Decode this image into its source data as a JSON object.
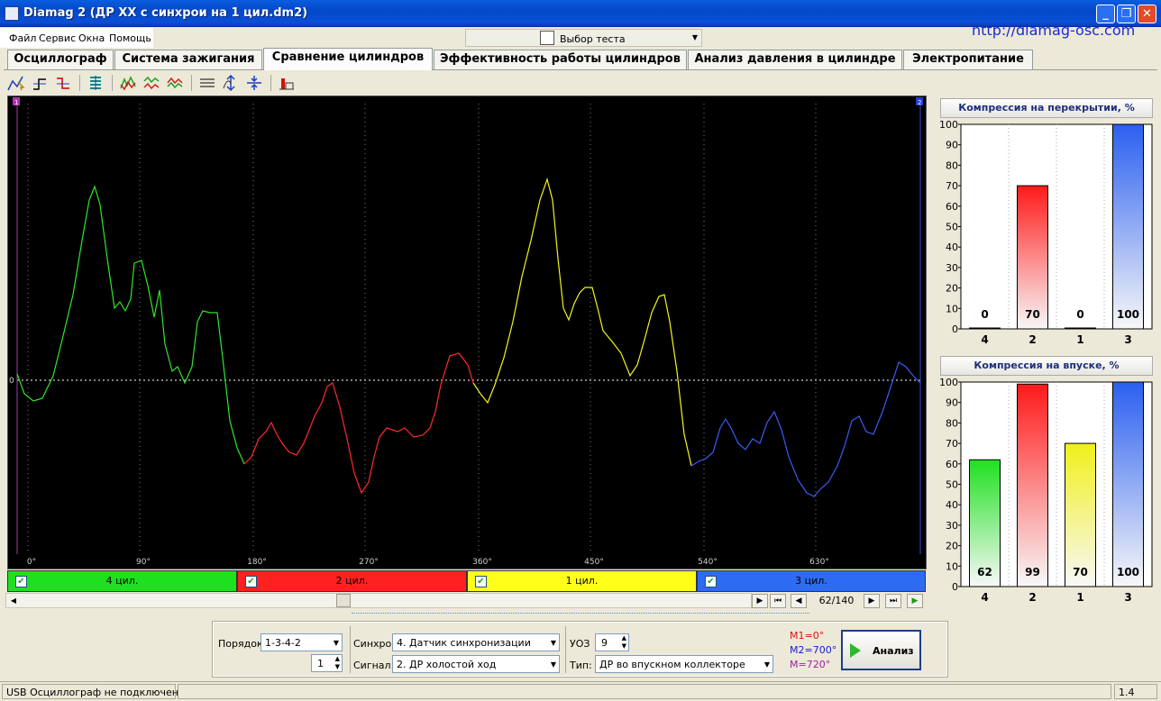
{
  "window": {
    "title": "Diamag 2 (ДР XX с синхрои на 1 цил.dm2)",
    "url": "http://diamag-osc.com"
  },
  "menu": [
    "Файл",
    "Сервис",
    "Окна",
    "Помощь"
  ],
  "test_select": "Выбор теста",
  "tabs": [
    "Осциллограф",
    "Система зажигания",
    "Сравнение цилиндров",
    "Эффективность работы цилиндров",
    "Анализ давления в цилиндре",
    "Электропитание"
  ],
  "active_tab": 2,
  "scope": {
    "x_ticks": [
      "0°",
      "90°",
      "180°",
      "270°",
      "360°",
      "450°",
      "540°",
      "630°"
    ],
    "zero_label": "0",
    "marker_left": "1",
    "marker_right": "2"
  },
  "channels": [
    {
      "label": "4 цил.",
      "color": "#1fe01f",
      "trace": "#2ee62e"
    },
    {
      "label": "2 цил.",
      "color": "#ff2020",
      "trace": "#ff2a2a"
    },
    {
      "label": "1 цил.",
      "color": "#ffff1a",
      "trace": "#f4f41c"
    },
    {
      "label": "3 цил.",
      "color": "#2d6bf4",
      "trace": "#3a5cf2"
    }
  ],
  "nav": {
    "page": "62/140"
  },
  "chart_data": [
    {
      "type": "bar",
      "title": "Компрессия на перекрытии, %",
      "categories": [
        "4",
        "2",
        "1",
        "3"
      ],
      "values": [
        0,
        70,
        0,
        100
      ],
      "ylim": [
        0,
        100
      ],
      "yticks": [
        0,
        10,
        20,
        30,
        40,
        50,
        60,
        70,
        80,
        90,
        100
      ],
      "colors": [
        "#20e020",
        "#ff1a1a",
        "#f0f01a",
        "#2a5ff0"
      ]
    },
    {
      "type": "bar",
      "title": "Компрессия на впуске, %",
      "categories": [
        "4",
        "2",
        "1",
        "3"
      ],
      "values": [
        62,
        99,
        70,
        100
      ],
      "ylim": [
        0,
        100
      ],
      "yticks": [
        0,
        10,
        20,
        30,
        40,
        50,
        60,
        70,
        80,
        90,
        100
      ],
      "colors": [
        "#20e020",
        "#ff1a1a",
        "#f0f01a",
        "#2a5ff0"
      ]
    }
  ],
  "bottom": {
    "order_label": "Порядок",
    "order_value": "1-3-4-2",
    "order_spin": "1",
    "sync_label": "Синхро:",
    "sync_value": "4. Датчик синхронизации",
    "signal_label": "Сигнал:",
    "signal_value": "2. ДР холостой ход",
    "uoz_label": "УОЗ",
    "uoz_value": "9",
    "type_label": "Тип:",
    "type_value": "ДР во впускном коллекторе",
    "m1": "M1=0°",
    "m2": "M2=700°",
    "m3": "M=720°",
    "m_colors": [
      "#e01010",
      "#1a1ad0",
      "#a020a0"
    ],
    "analyze": "Анализ"
  },
  "status": {
    "left": "USB Осциллограф не подключен",
    "right": "1.4"
  }
}
